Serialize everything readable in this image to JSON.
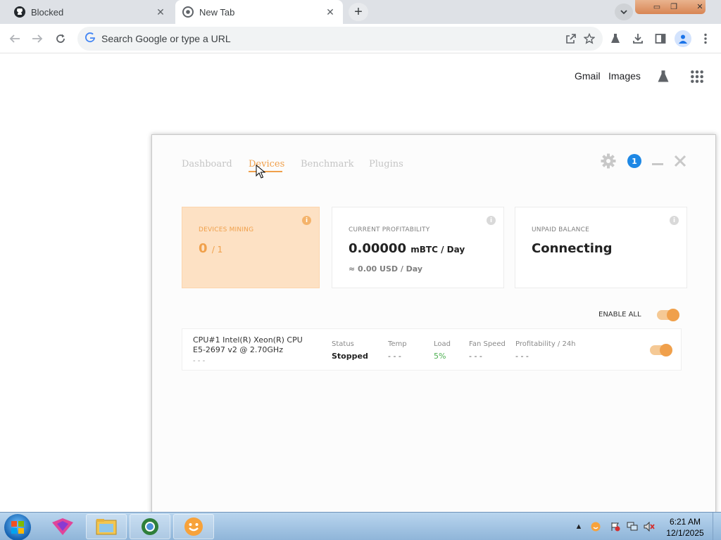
{
  "browser": {
    "tabs": [
      {
        "title": "Blocked",
        "icon": "github-icon"
      },
      {
        "title": "New Tab",
        "icon": "chrome-icon"
      }
    ],
    "omnibox": {
      "placeholder": "Search Google or type a URL"
    }
  },
  "ntp": {
    "links": [
      "Gmail",
      "Images"
    ]
  },
  "app": {
    "nav": [
      "Dashboard",
      "Devices",
      "Benchmark",
      "Plugins"
    ],
    "active_nav": "Devices",
    "notification_count": "1",
    "cards": {
      "mining": {
        "label": "DEVICES MINING",
        "value": "0",
        "total": "/ 1"
      },
      "profit": {
        "label": "CURRENT PROFITABILITY",
        "value": "0.00000",
        "unit": "mBTC / Day",
        "usd": "≈ 0.00 USD / Day"
      },
      "balance": {
        "label": "UNPAID BALANCE",
        "value": "Connecting"
      }
    },
    "enable_all_label": "ENABLE ALL",
    "device": {
      "name": "CPU#1 Intel(R) Xeon(R) CPU E5-2697 v2 @ 2.70GHz",
      "sub": "- - -",
      "columns": {
        "status": {
          "label": "Status",
          "value": "Stopped"
        },
        "temp": {
          "label": "Temp",
          "value": "- - -"
        },
        "load": {
          "label": "Load",
          "value": "5%"
        },
        "fan": {
          "label": "Fan Speed",
          "value": "- - -"
        },
        "profit": {
          "label": "Profitability / 24h",
          "value": "- - -"
        }
      }
    },
    "accent_color": "#f0a04b"
  },
  "taskbar": {
    "time": "6:21 AM",
    "date": "12/1/2025"
  }
}
